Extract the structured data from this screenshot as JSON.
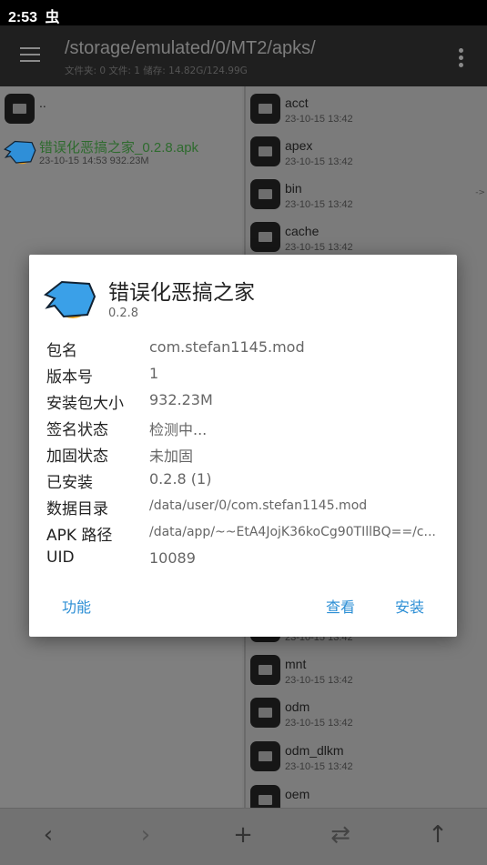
{
  "status": {
    "time": "2:53",
    "notif_icon": "bug-icon"
  },
  "toolbar": {
    "path": "/storage/emulated/0/MT2/apks/",
    "info": "文件夹: 0  文件: 1  储存: 14.82G/124.99G"
  },
  "left_panel": {
    "items": [
      {
        "name": "..",
        "date": "",
        "type": "folder"
      },
      {
        "name": "错误化恶搞之家_0.2.8.apk",
        "date": "23-10-15 14:53  932.23M",
        "type": "apk",
        "color": "#2e7d32"
      }
    ]
  },
  "right_panel": {
    "items_top": [
      {
        "name": "acct",
        "date": "23-10-15 13:42",
        "link": ""
      },
      {
        "name": "apex",
        "date": "23-10-15 13:42",
        "link": ""
      },
      {
        "name": "bin",
        "date": "23-10-15 13:42",
        "link": "->"
      },
      {
        "name": "cache",
        "date": "23-10-15 13:42",
        "link": ""
      }
    ],
    "items_bottom": [
      {
        "name": "",
        "date": "23-10-15 13:42"
      },
      {
        "name": "mnt",
        "date": "23-10-15 13:42"
      },
      {
        "name": "odm",
        "date": "23-10-15 13:42"
      },
      {
        "name": "odm_dlkm",
        "date": "23-10-15 13:42"
      },
      {
        "name": "oem",
        "date": ""
      }
    ]
  },
  "dialog": {
    "title": "错误化恶搞之家",
    "version": "0.2.8",
    "rows": [
      {
        "k": "包名",
        "v": "com.stefan1145.mod"
      },
      {
        "k": "版本号",
        "v": "1"
      },
      {
        "k": "安装包大小",
        "v": "932.23M"
      },
      {
        "k": "签名状态",
        "v": "检测中..."
      },
      {
        "k": "加固状态",
        "v": "未加固"
      },
      {
        "k": "已安装",
        "v": "0.2.8 (1)"
      },
      {
        "k": "数据目录",
        "v": "/data/user/0/com.stefan1145.mod"
      },
      {
        "k": "APK 路径",
        "v": "/data/app/~~EtA4JojK36koCg90TIllBQ==/c..."
      },
      {
        "k": "UID",
        "v": "10089"
      }
    ],
    "buttons": {
      "functions": "功能",
      "view": "查看",
      "install": "安装"
    },
    "accent": "#2d8fd5"
  },
  "bottom": {
    "icons": [
      "chevron-left-icon",
      "chevron-right-icon",
      "plus-icon",
      "swap-icon",
      "arrow-up-icon"
    ],
    "glyphs": [
      "‹",
      "›",
      "+",
      "⇄",
      "↑"
    ]
  }
}
